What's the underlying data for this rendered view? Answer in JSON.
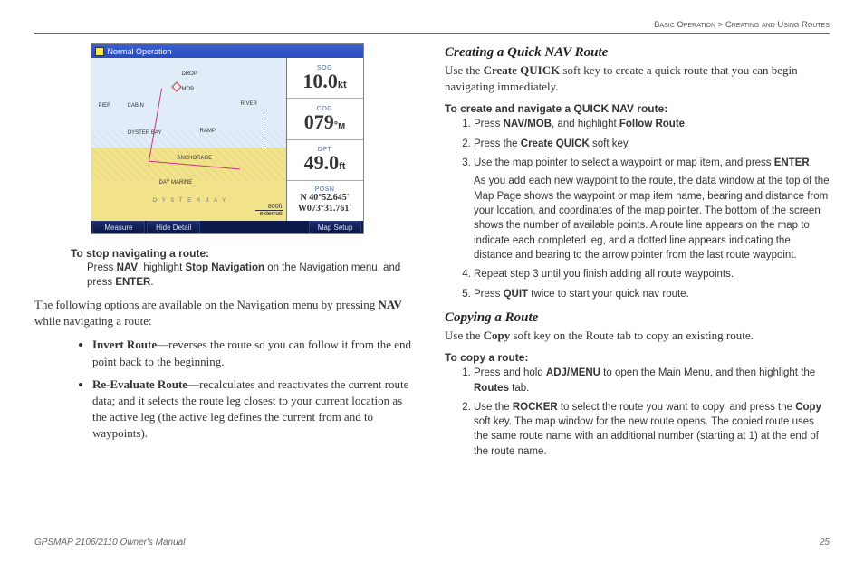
{
  "header": {
    "section": "Basic Operation",
    "subsection": "Creating and Using Routes"
  },
  "device": {
    "mode": "Normal Operation",
    "map_labels": {
      "drop": "DROP",
      "mob": "MOB",
      "pier": "PIER",
      "cabin": "CABIN",
      "oyster": "OYSTER BAY",
      "ramp": "RAMP",
      "anchorage": "ANCHORAGE",
      "daymarine": "DAY MARINE",
      "oysterbay_big": "O Y S T E R B A Y",
      "river": "RIVER"
    },
    "scale_top": "800ft",
    "scale_bot": "external",
    "fields": {
      "sog_label": "SOG",
      "sog_val": "10.0",
      "sog_unit": "kt",
      "cog_label": "COG",
      "cog_val": "079",
      "cog_unit": "°ᴍ",
      "dpt_label": "DPT",
      "dpt_val": "49.0",
      "dpt_unit": "ft",
      "posn_label": "POSN",
      "posn_lat": "N  40°52.645'",
      "posn_lon": "W073°31.761'"
    },
    "softkeys": {
      "k1": "Measure",
      "k2": "Hide Detail",
      "k3": "Map Setup"
    }
  },
  "left": {
    "proc1_title": "To stop navigating a route:",
    "proc1_body_a": "Press ",
    "proc1_body_b": "NAV",
    "proc1_body_c": ", highlight ",
    "proc1_body_d": "Stop Navigation",
    "proc1_body_e": " on the Navigation menu, and press ",
    "proc1_body_f": "ENTER",
    "proc1_body_g": ".",
    "intro_a": "The following options are available on the Navigation menu by pressing ",
    "intro_b": "NAV",
    "intro_c": " while navigating a route:",
    "bullet1_a": "Invert Route",
    "bullet1_b": "—reverses the route so you can follow it from the end point back to the beginning.",
    "bullet2_a": "Re-Evaluate Route",
    "bullet2_b": "—recalculates and reactivates the current route data; and it selects the route leg closest to your current location as the active leg (the active leg defines the current from and to waypoints)."
  },
  "right": {
    "h1": "Creating a Quick NAV Route",
    "p1_a": "Use the ",
    "p1_b": "Create QUICK",
    "p1_c": " soft key to create a quick route that you can begin navigating immediately.",
    "proc2_title": "To create and navigate a QUICK NAV route:",
    "s1_a": "Press ",
    "s1_b": "NAV/MOB",
    "s1_c": ", and highlight ",
    "s1_d": "Follow Route",
    "s1_e": ".",
    "s2_a": "Press the ",
    "s2_b": "Create QUICK",
    "s2_c": " soft key.",
    "s3_a": "Use the map pointer to select a waypoint or map item, and press ",
    "s3_b": "ENTER",
    "s3_c": ".",
    "s3_sub": "As you add each new waypoint to the route, the data window at the top of the Map Page shows the waypoint or map item name, bearing and distance from your location, and coordinates of the map pointer. The bottom of the screen shows the number of available points. A route line appears on the map to indicate each completed leg, and a dotted line appears indicating the distance and bearing to the arrow pointer from the last route waypoint.",
    "s4": "Repeat step 3 until you finish adding all route waypoints.",
    "s5_a": "Press ",
    "s5_b": "QUIT",
    "s5_c": " twice to start your quick nav route.",
    "h2": "Copying a Route",
    "p2_a": "Use the ",
    "p2_b": "Copy",
    "p2_c": " soft key on the Route tab to copy an existing route.",
    "proc3_title": "To copy a route:",
    "c1_a": "Press and hold ",
    "c1_b": "ADJ/MENU",
    "c1_c": " to open the Main Menu, and then highlight the ",
    "c1_d": "Routes",
    "c1_e": " tab.",
    "c2_a": "Use the ",
    "c2_b": "ROCKER",
    "c2_c": " to select the route you want to copy, and press the ",
    "c2_d": "Copy",
    "c2_e": " soft key. The map window for the new route opens. The copied route uses the same route name with an additional number (starting at 1) at the end of the route name."
  },
  "footer": {
    "manual": "GPSMAP 2106/2110 Owner's Manual",
    "page": "25"
  }
}
